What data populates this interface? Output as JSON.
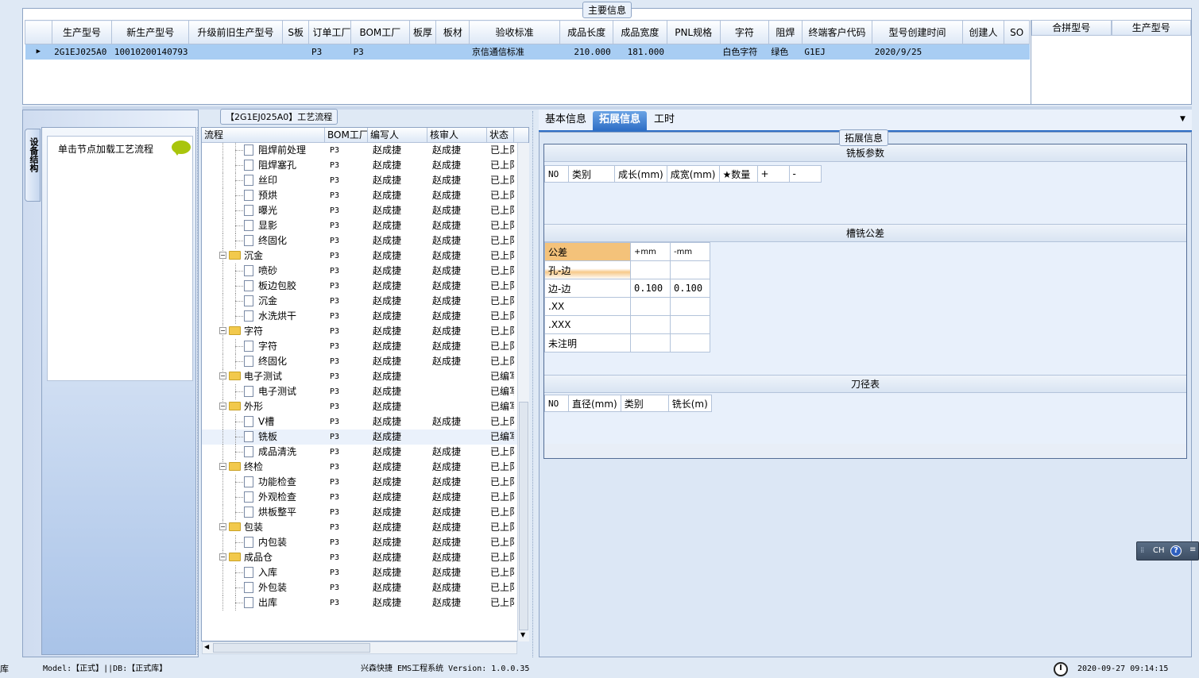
{
  "main_info": {
    "title": "主要信息",
    "columns": [
      "生产型号",
      "新生产型号",
      "升级前旧生产型号",
      "S板",
      "订单工厂",
      "BOM工厂",
      "板厚",
      "板材",
      "验收标准",
      "成品长度",
      "成品宽度",
      "PNL规格",
      "字符",
      "阻焊",
      "终端客户代码",
      "型号创建时间",
      "创建人",
      "SO"
    ],
    "row": [
      "2G1EJ025A0",
      "10010200140793",
      "",
      "",
      "P3",
      "P3",
      "",
      "",
      "京信通信标准",
      "210.000",
      "181.000",
      "",
      "白色字符",
      "绿色",
      "G1EJ",
      "2020/9/25",
      "",
      ""
    ],
    "side_columns": [
      "合拼型号",
      "生产型号"
    ]
  },
  "left_tab": {
    "label": "设备结构",
    "hint": "单击节点加载工艺流程"
  },
  "process": {
    "title": "【2G1EJ025A0】工艺流程",
    "columns": [
      "流程",
      "BOM工厂",
      "编写人",
      "核审人",
      "状态"
    ],
    "rows": [
      {
        "name": "阻焊前处理",
        "level": 2,
        "folder": false,
        "bom": "P3",
        "writer": "赵成捷",
        "reviewer": "赵成捷",
        "status": "已上阝"
      },
      {
        "name": "阻焊塞孔",
        "level": 2,
        "folder": false,
        "bom": "P3",
        "writer": "赵成捷",
        "reviewer": "赵成捷",
        "status": "已上阝"
      },
      {
        "name": "丝印",
        "level": 2,
        "folder": false,
        "bom": "P3",
        "writer": "赵成捷",
        "reviewer": "赵成捷",
        "status": "已上阝"
      },
      {
        "name": "预烘",
        "level": 2,
        "folder": false,
        "bom": "P3",
        "writer": "赵成捷",
        "reviewer": "赵成捷",
        "status": "已上阝"
      },
      {
        "name": "曝光",
        "level": 2,
        "folder": false,
        "bom": "P3",
        "writer": "赵成捷",
        "reviewer": "赵成捷",
        "status": "已上阝"
      },
      {
        "name": "显影",
        "level": 2,
        "folder": false,
        "bom": "P3",
        "writer": "赵成捷",
        "reviewer": "赵成捷",
        "status": "已上阝"
      },
      {
        "name": "终固化",
        "level": 2,
        "folder": false,
        "bom": "P3",
        "writer": "赵成捷",
        "reviewer": "赵成捷",
        "status": "已上阝"
      },
      {
        "name": "沉金",
        "level": 1,
        "folder": true,
        "bom": "P3",
        "writer": "赵成捷",
        "reviewer": "赵成捷",
        "status": "已上阝"
      },
      {
        "name": "喷砂",
        "level": 2,
        "folder": false,
        "bom": "P3",
        "writer": "赵成捷",
        "reviewer": "赵成捷",
        "status": "已上阝"
      },
      {
        "name": "板边包胶",
        "level": 2,
        "folder": false,
        "bom": "P3",
        "writer": "赵成捷",
        "reviewer": "赵成捷",
        "status": "已上阝"
      },
      {
        "name": "沉金",
        "level": 2,
        "folder": false,
        "bom": "P3",
        "writer": "赵成捷",
        "reviewer": "赵成捷",
        "status": "已上阝"
      },
      {
        "name": "水洗烘干",
        "level": 2,
        "folder": false,
        "bom": "P3",
        "writer": "赵成捷",
        "reviewer": "赵成捷",
        "status": "已上阝"
      },
      {
        "name": "字符",
        "level": 1,
        "folder": true,
        "bom": "P3",
        "writer": "赵成捷",
        "reviewer": "赵成捷",
        "status": "已上阝"
      },
      {
        "name": "字符",
        "level": 2,
        "folder": false,
        "bom": "P3",
        "writer": "赵成捷",
        "reviewer": "赵成捷",
        "status": "已上阝"
      },
      {
        "name": "终固化",
        "level": 2,
        "folder": false,
        "bom": "P3",
        "writer": "赵成捷",
        "reviewer": "赵成捷",
        "status": "已上阝"
      },
      {
        "name": "电子测试",
        "level": 1,
        "folder": true,
        "bom": "P3",
        "writer": "赵成捷",
        "reviewer": "",
        "status": "已编写"
      },
      {
        "name": "电子测试",
        "level": 2,
        "folder": false,
        "bom": "P3",
        "writer": "赵成捷",
        "reviewer": "",
        "status": "已编写"
      },
      {
        "name": "外形",
        "level": 1,
        "folder": true,
        "bom": "P3",
        "writer": "赵成捷",
        "reviewer": "",
        "status": "已编写"
      },
      {
        "name": "V槽",
        "level": 2,
        "folder": false,
        "bom": "P3",
        "writer": "赵成捷",
        "reviewer": "赵成捷",
        "status": "已上阝"
      },
      {
        "name": "铣板",
        "level": 2,
        "folder": false,
        "bom": "P3",
        "writer": "赵成捷",
        "reviewer": "",
        "status": "已编写"
      },
      {
        "name": "成品清洗",
        "level": 2,
        "folder": false,
        "bom": "P3",
        "writer": "赵成捷",
        "reviewer": "赵成捷",
        "status": "已上阝"
      },
      {
        "name": "终检",
        "level": 1,
        "folder": true,
        "bom": "P3",
        "writer": "赵成捷",
        "reviewer": "赵成捷",
        "status": "已上阝"
      },
      {
        "name": "功能检查",
        "level": 2,
        "folder": false,
        "bom": "P3",
        "writer": "赵成捷",
        "reviewer": "赵成捷",
        "status": "已上阝"
      },
      {
        "name": "外观检查",
        "level": 2,
        "folder": false,
        "bom": "P3",
        "writer": "赵成捷",
        "reviewer": "赵成捷",
        "status": "已上阝"
      },
      {
        "name": "烘板整平",
        "level": 2,
        "folder": false,
        "bom": "P3",
        "writer": "赵成捷",
        "reviewer": "赵成捷",
        "status": "已上阝"
      },
      {
        "name": "包装",
        "level": 1,
        "folder": true,
        "bom": "P3",
        "writer": "赵成捷",
        "reviewer": "赵成捷",
        "status": "已上阝"
      },
      {
        "name": "内包装",
        "level": 2,
        "folder": false,
        "bom": "P3",
        "writer": "赵成捷",
        "reviewer": "赵成捷",
        "status": "已上阝"
      },
      {
        "name": "成品仓",
        "level": 1,
        "folder": true,
        "bom": "P3",
        "writer": "赵成捷",
        "reviewer": "赵成捷",
        "status": "已上阝"
      },
      {
        "name": "入库",
        "level": 2,
        "folder": false,
        "bom": "P3",
        "writer": "赵成捷",
        "reviewer": "赵成捷",
        "status": "已上阝"
      },
      {
        "name": "外包装",
        "level": 2,
        "folder": false,
        "bom": "P3",
        "writer": "赵成捷",
        "reviewer": "赵成捷",
        "status": "已上阝"
      },
      {
        "name": "出库",
        "level": 2,
        "folder": false,
        "bom": "P3",
        "writer": "赵成捷",
        "reviewer": "赵成捷",
        "status": "已上阝"
      }
    ],
    "selected_index": 19
  },
  "tabs": [
    "基本信息",
    "拓展信息",
    "工时"
  ],
  "active_tab": 1,
  "ext": {
    "title": "拓展信息",
    "mill_params": {
      "title": "铣板参数",
      "columns": [
        "NO",
        "类别",
        "成长(mm)",
        "成宽(mm)",
        "★数量",
        "+",
        "-"
      ]
    },
    "mill_tol": {
      "title": "槽铣公差",
      "header": [
        "公差",
        "+mm",
        "-mm"
      ],
      "rows": [
        [
          "孔-边",
          "",
          ""
        ],
        [
          "边-边",
          "0.100",
          "0.100"
        ],
        [
          ".XX",
          "",
          ""
        ],
        [
          ".XXX",
          "",
          ""
        ],
        [
          "未注明",
          "",
          ""
        ]
      ]
    },
    "tool_table": {
      "title": "刀径表",
      "columns": [
        "NO",
        "直径(mm)",
        "类别",
        "铣长(m)"
      ]
    }
  },
  "ime": {
    "label": "CH"
  },
  "status": {
    "left_text": "库",
    "model": "Model:【正式】||DB:【正式库】",
    "app": "兴森快捷 EMS工程系统 Version: 1.0.0.35",
    "datetime": "2020-09-27 09:14:15"
  },
  "colors": {
    "selected_row": "#a8cdf3",
    "active_tab": "#2f6fc6",
    "tol_header": "#f4c27a"
  }
}
